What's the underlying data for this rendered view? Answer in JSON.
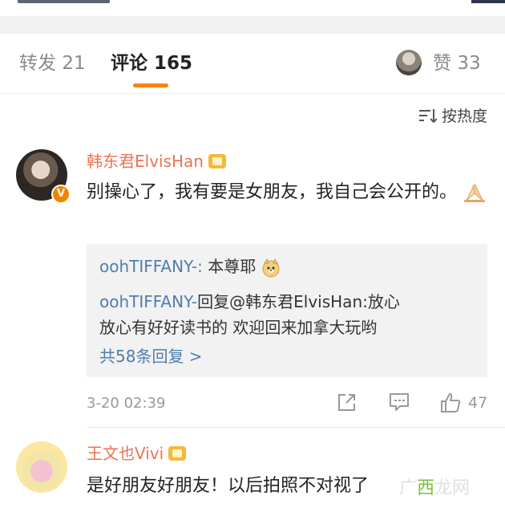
{
  "tabs": {
    "repost": {
      "label": "转发",
      "count": "21"
    },
    "comment": {
      "label": "评论",
      "count": "165"
    },
    "like": {
      "label": "赞",
      "count": "33"
    }
  },
  "sort": {
    "label": "按热度",
    "icon": "sort-icon"
  },
  "comments": [
    {
      "username": "韩东君ElvisHan",
      "verified_badge": "V",
      "text": "别操心了，我有要是女朋友，我自己会公开的。",
      "emoji": "pray-hands-emoji",
      "replies": [
        {
          "nick": "oohTIFFANY-:",
          "text": " 本尊耶",
          "emoji": "doge-emoji"
        },
        {
          "nick": "oohTIFFANY-",
          "text": "回复@韩东君ElvisHan:放心",
          "text2": "放心有好好读书的 欢迎回来加拿大玩哟"
        }
      ],
      "more_replies": "共58条回复 >",
      "time": "3-20 02:39",
      "like_count": "47"
    },
    {
      "username": "王文也Vivi",
      "text": "是好朋友好朋友！以后拍照不对视了"
    }
  ],
  "watermark": {
    "prefix": "广",
    "main": "西",
    "suffix": "龙网"
  },
  "colors": {
    "accent": "#ff8200",
    "username": "#eb7350",
    "link": "#507daf"
  }
}
